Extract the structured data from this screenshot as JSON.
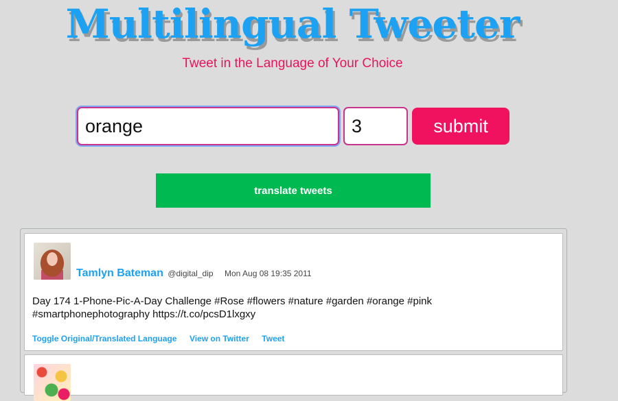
{
  "header": {
    "title": "Multilingual Tweeter",
    "subtitle": "Tweet in the Language of Your Choice"
  },
  "form": {
    "search_value": "orange",
    "count_value": "3",
    "submit_label": "submit"
  },
  "translate_button_label": "translate tweets",
  "tweets": [
    {
      "name": "Tamlyn Bateman",
      "handle": "@digital_dip",
      "time": "Mon Aug 08 19:35 2011",
      "text": "Day 174 1-Phone-Pic-A-Day Challenge #Rose #flowers #nature #garden #orange #pink #smartphonephotography https://t.co/pcsD1lxgxy",
      "actions": {
        "toggle": "Toggle Original/Translated Language",
        "view": "View on Twitter",
        "tweet": "Tweet"
      }
    }
  ],
  "colors": {
    "title": "#1da1f2",
    "accent_pink": "#f0115f",
    "accent_green": "#00b951",
    "background": "#dcdcdc"
  }
}
